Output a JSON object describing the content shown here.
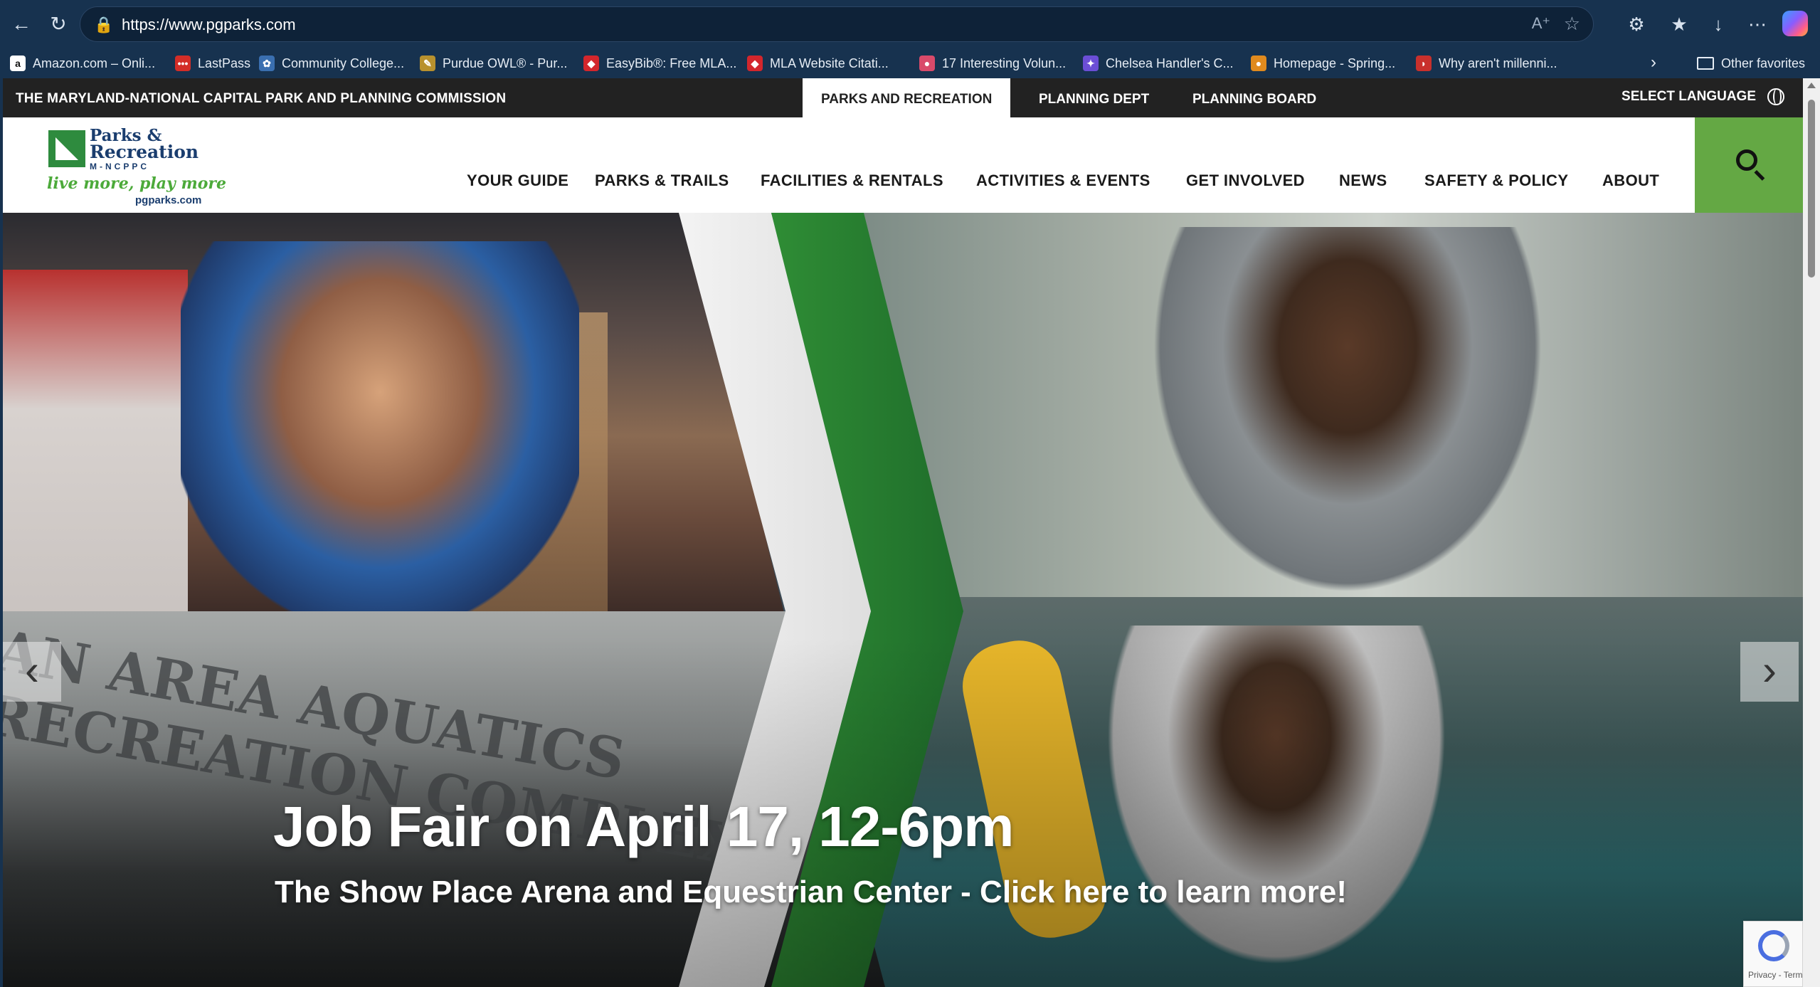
{
  "browser": {
    "url": "https://www.pgparks.com",
    "back_icon": "arrow-left",
    "refresh_icon": "refresh",
    "favorites": [
      {
        "label": "Amazon.com – Onli...",
        "color": "#ffffff"
      },
      {
        "label": "LastPass",
        "color": "#d32d27"
      },
      {
        "label": "Community College...",
        "color": "#3a6fb0"
      },
      {
        "label": "Purdue OWL® - Pur...",
        "color": "#b8912e"
      },
      {
        "label": "EasyBib®: Free MLA...",
        "color": "#d3262c"
      },
      {
        "label": "MLA Website Citati...",
        "color": "#d3262c"
      },
      {
        "label": "17 Interesting Volun...",
        "color": "#d94a6a"
      },
      {
        "label": "Chelsea Handler's C...",
        "color": "#6b4ed6"
      },
      {
        "label": "Homepage - Spring...",
        "color": "#e08a1e"
      },
      {
        "label": "Why aren't millenni...",
        "color": "#c9302c"
      }
    ],
    "other_favorites": "Other favorites"
  },
  "site": {
    "commission": "THE MARYLAND-NATIONAL CAPITAL PARK AND PLANNING COMMISSION",
    "top_tabs": [
      "PARKS AND RECREATION",
      "PLANNING DEPT",
      "PLANNING BOARD"
    ],
    "select_language": "SELECT LANGUAGE",
    "logo": {
      "line1": "Parks &",
      "line2": "Recreation",
      "line3": "M-NCPPC",
      "tagline": "live more, play more",
      "site": "pgparks.com"
    },
    "nav": [
      "YOUR GUIDE",
      "PARKS & TRAILS",
      "FACILITIES & RENTALS",
      "ACTIVITIES & EVENTS",
      "GET INVOLVED",
      "NEWS",
      "SAFETY & POLICY",
      "ABOUT"
    ],
    "accent_green": "#64a844",
    "hero": {
      "headline": "Job Fair on April 17, 12-6pm",
      "subline": "The Show Place Arena and Equestrian Center - Click here to learn more!",
      "wall_text": "AN AREA AQUATICS\nRECREATION COMPLEX"
    },
    "recaptcha": "Privacy - Terms"
  }
}
